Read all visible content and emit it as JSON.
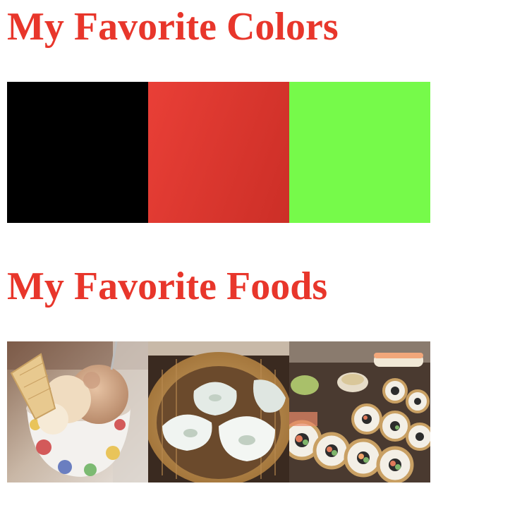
{
  "headings": {
    "colors": "My Favorite Colors",
    "foods": "My Favorite Foods"
  },
  "heading_color": "#e8362b",
  "colors": [
    {
      "name": "black",
      "hex": "#000000"
    },
    {
      "name": "red",
      "hex": "#e8352c"
    },
    {
      "name": "green",
      "hex": "#76fa4a"
    }
  ],
  "foods": [
    {
      "name": "ice-cream"
    },
    {
      "name": "dumplings"
    },
    {
      "name": "sushi"
    }
  ]
}
